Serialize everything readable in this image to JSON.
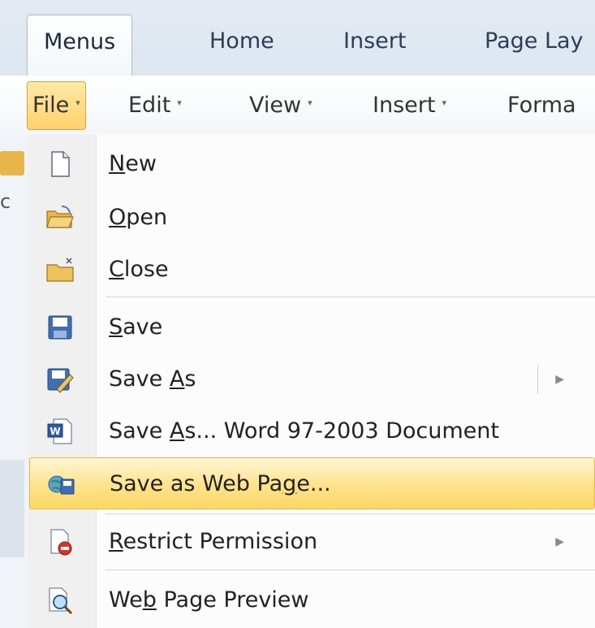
{
  "ribbon": {
    "tabs": [
      {
        "label": "Menus",
        "active": true
      },
      {
        "label": "Home"
      },
      {
        "label": "Insert"
      },
      {
        "label": "Page Lay"
      }
    ]
  },
  "menubar": {
    "items": [
      {
        "label": "File",
        "open": true
      },
      {
        "label": "Edit"
      },
      {
        "label": "View"
      },
      {
        "label": "Insert"
      },
      {
        "label": "Forma"
      }
    ],
    "dropdown_arrow": "▾"
  },
  "behind": {
    "glyph": "c"
  },
  "file_menu": {
    "items": [
      {
        "label_pre": "",
        "accel": "N",
        "label_post": "ew",
        "icon": "new-document-icon"
      },
      {
        "label_pre": "",
        "accel": "O",
        "label_post": "pen",
        "icon": "open-folder-icon"
      },
      {
        "label_pre": "",
        "accel": "C",
        "label_post": "lose",
        "icon": "close-folder-icon"
      },
      {
        "label_pre": "",
        "accel": "S",
        "label_post": "ave",
        "icon": "save-disk-icon"
      },
      {
        "label_pre": "Save ",
        "accel": "A",
        "label_post": "s",
        "icon": "save-as-icon",
        "submenu": true
      },
      {
        "label_pre": "Save ",
        "accel": "A",
        "label_post": "s... Word 97-2003 Document",
        "icon": "word-document-icon"
      },
      {
        "label_pre": "Save as Web Pa",
        "accel": "g",
        "label_post": "e...",
        "icon": "web-page-icon",
        "highlighted": true
      },
      {
        "label_pre": "",
        "accel": "R",
        "label_post": "estrict Permission",
        "icon": "restrict-permission-icon",
        "submenu": true
      },
      {
        "label_pre": "We",
        "accel": "b",
        "label_post": " Page Preview",
        "icon": "web-preview-icon"
      }
    ],
    "submenu_arrow": "▶"
  },
  "colors": {
    "highlight": "#ffd863",
    "open_menu": "#ffd26b",
    "ribbon_bg": "#e3eaf3"
  }
}
